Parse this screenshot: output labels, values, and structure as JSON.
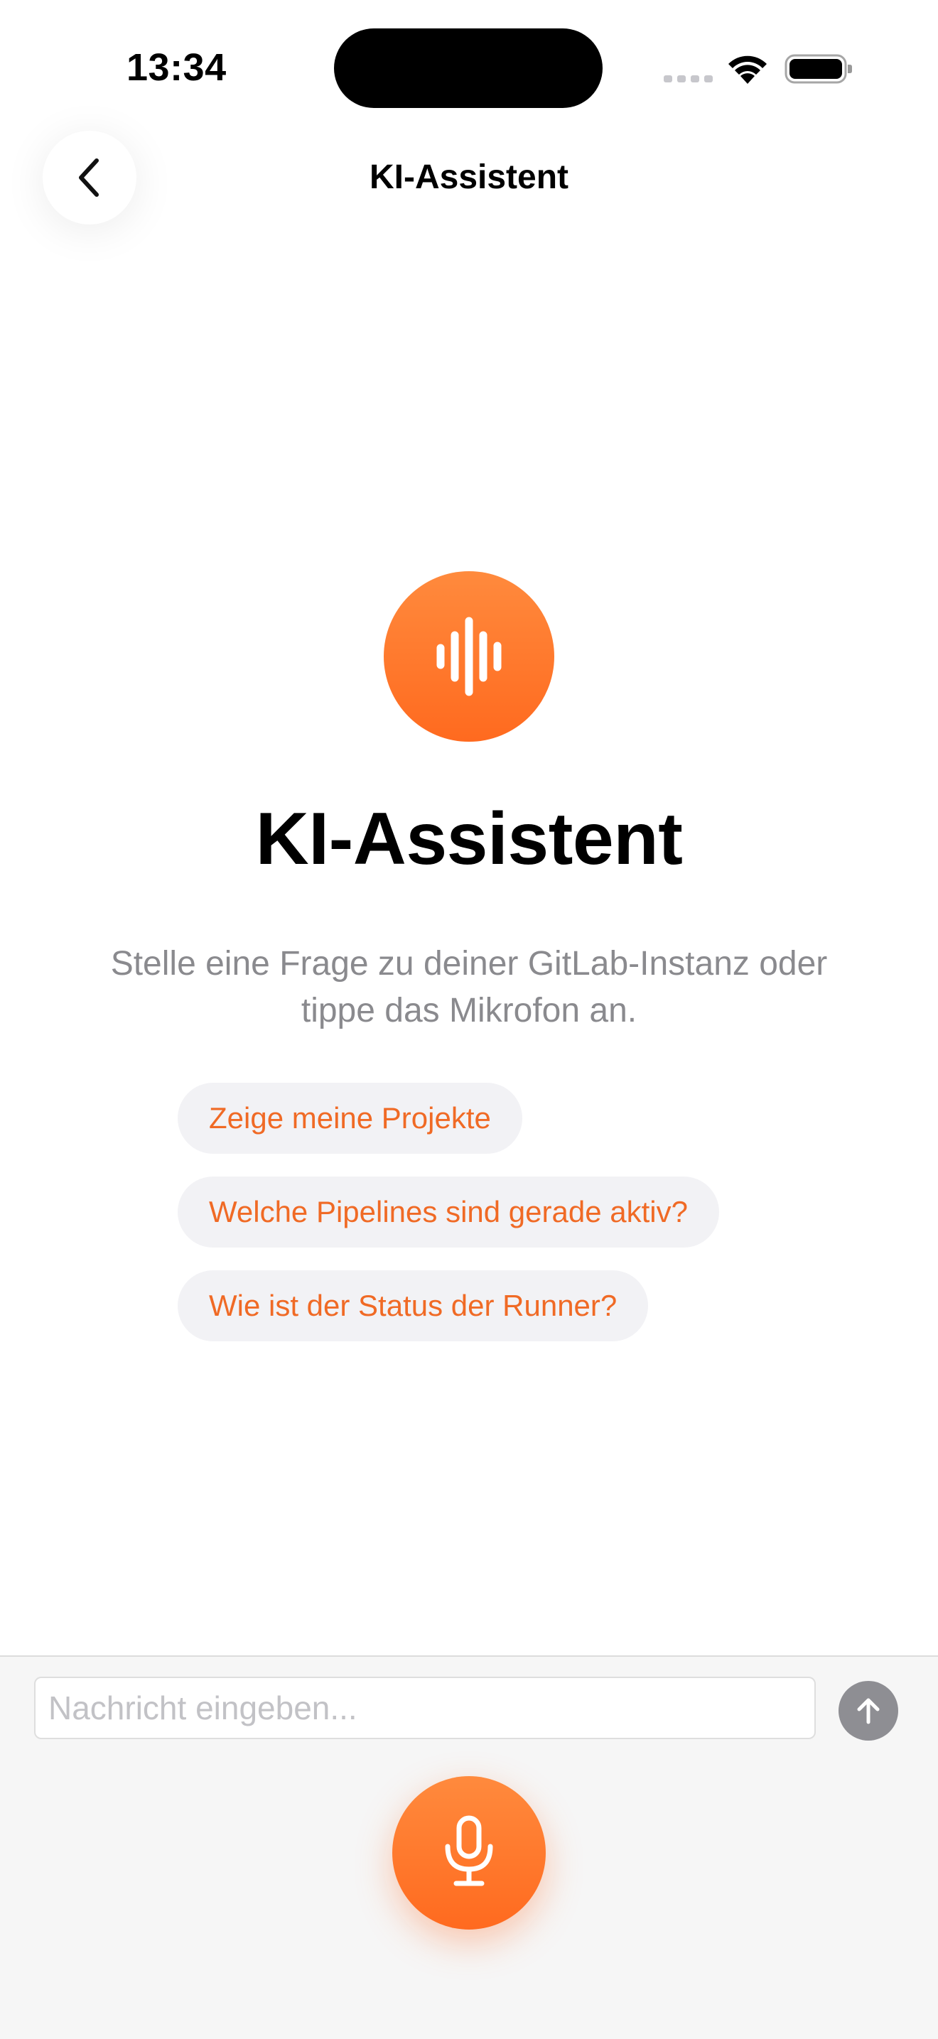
{
  "status_bar": {
    "time": "13:34"
  },
  "nav": {
    "title": "KI-Assistent",
    "back_icon": "chevron-left-icon"
  },
  "hero": {
    "icon": "waveform-icon",
    "title": "KI-Assistent",
    "subtitle": "Stelle eine Frage zu deiner GitLab-Instanz oder tippe das Mikrofon an."
  },
  "suggestions": [
    {
      "label": "Zeige meine Projekte"
    },
    {
      "label": "Welche Pipelines sind gerade aktiv?"
    },
    {
      "label": "Wie ist der Status der Runner?"
    }
  ],
  "composer": {
    "value": "",
    "placeholder": "Nachricht eingeben...",
    "send_icon": "arrow-up-icon",
    "mic_icon": "microphone-icon"
  },
  "colors": {
    "accent": "#ff6a1f",
    "chip_background": "#f2f2f5",
    "chip_text": "#f06a25",
    "subtitle_text": "#8a8a8e",
    "send_button": "#8e8e93"
  }
}
